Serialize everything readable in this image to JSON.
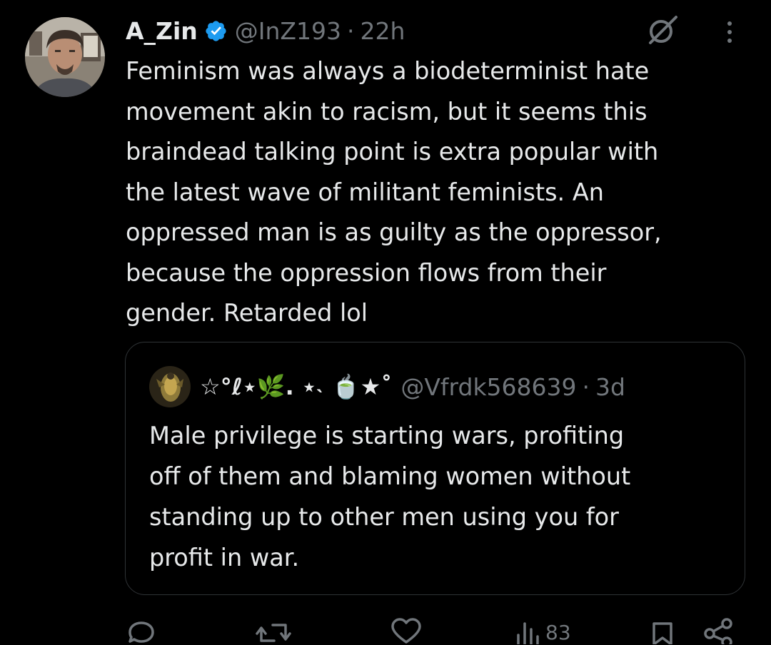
{
  "tweet": {
    "display_name": "A_Zin",
    "handle": "@InZ193",
    "separator": "·",
    "time": "22h",
    "text": "Feminism was always a biodeterminist hate\nmovement akin to racism, but it seems this\nbraindead talking point is extra popular with\nthe latest wave of militant feminists. An\noppressed man is as guilty as the oppressor,\nbecause the oppression flows from their\ngender. Retarded lol"
  },
  "quote": {
    "display_name": "☆°ℓ⋆🌿. ⋆˴ 🍵★˚",
    "handle": "@Vfrdk568639",
    "separator": "·",
    "time": "3d",
    "text": "Male privilege is starting wars, profiting\noff of them and blaming women without\nstanding up to other men using you for\nprofit in war."
  },
  "actions": {
    "views": "83"
  },
  "colors": {
    "background": "#000000",
    "text": "#e7e9ea",
    "secondary": "#71767b",
    "border": "#2f3336",
    "verified": "#1d9bf0"
  },
  "icons": [
    "verified-badge-icon",
    "grok-icon",
    "more-icon",
    "reply-icon",
    "retweet-icon",
    "like-icon",
    "views-icon",
    "bookmark-icon",
    "share-icon"
  ]
}
